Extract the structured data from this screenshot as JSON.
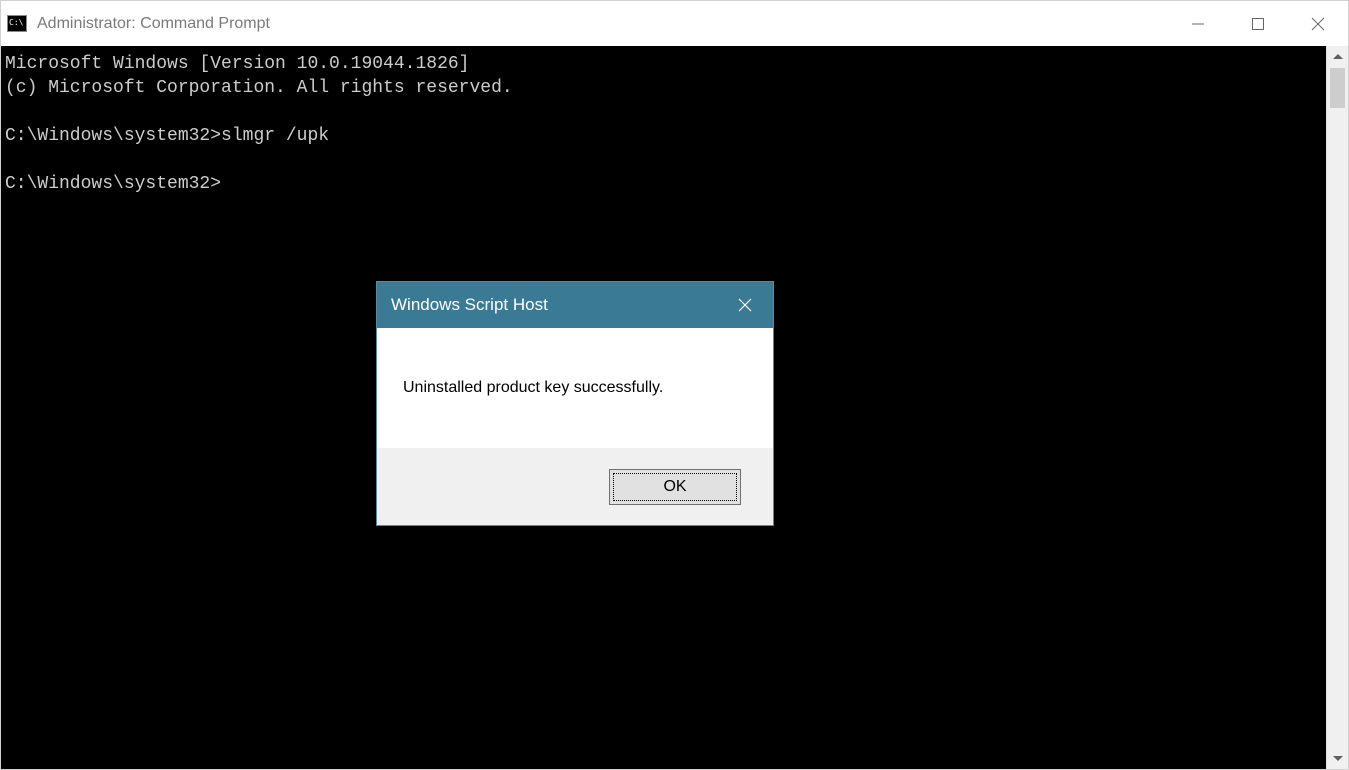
{
  "window": {
    "title": "Administrator: Command Prompt"
  },
  "terminal": {
    "lines": [
      "Microsoft Windows [Version 10.0.19044.1826]",
      "(c) Microsoft Corporation. All rights reserved.",
      "",
      "C:\\Windows\\system32>slmgr /upk",
      "",
      "C:\\Windows\\system32>"
    ]
  },
  "dialog": {
    "title": "Windows Script Host",
    "message": "Uninstalled product key successfully.",
    "ok_label": "OK"
  }
}
